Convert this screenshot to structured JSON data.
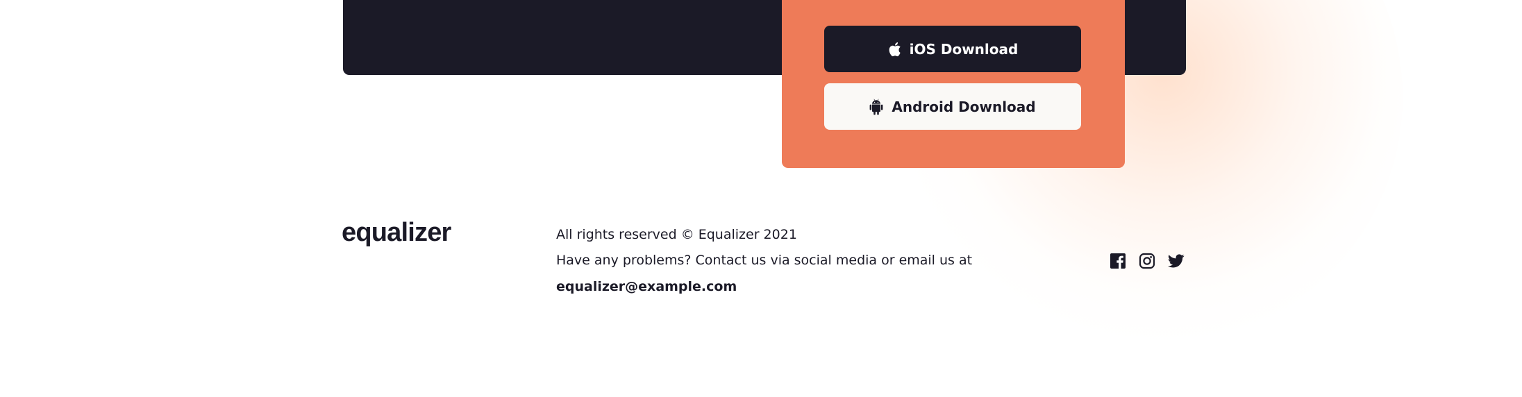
{
  "download": {
    "ios_label": "iOS Download",
    "ios_icon": "apple-icon",
    "android_label": "Android Download",
    "android_icon": "android-icon"
  },
  "footer": {
    "logo": "equalizer",
    "rights": "All rights reserved © Equalizer 2021",
    "contact": "Have any problems? Contact us via social media or email us at",
    "email": "equalizer@example.com",
    "social": [
      "facebook-icon",
      "instagram-icon",
      "twitter-icon"
    ]
  },
  "colors": {
    "dark": "#1b1a27",
    "accent": "#ee7b58",
    "light_button": "#faf9f6",
    "glow": "#ffd7be"
  }
}
